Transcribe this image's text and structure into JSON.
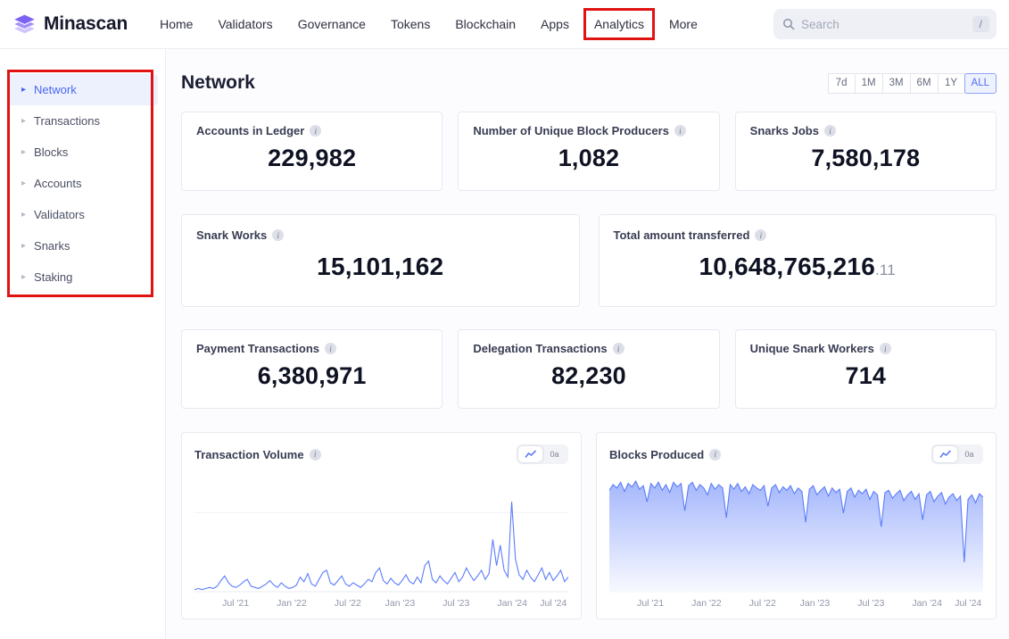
{
  "colors": {
    "accent": "#5b7cfa",
    "annotation": "#e01313",
    "active_blue": "#4a66f0"
  },
  "navbar": {
    "brand": "Minascan",
    "items": [
      {
        "label": "Home"
      },
      {
        "label": "Validators"
      },
      {
        "label": "Governance"
      },
      {
        "label": "Tokens"
      },
      {
        "label": "Blockchain"
      },
      {
        "label": "Apps"
      },
      {
        "label": "Analytics",
        "annotated": true
      },
      {
        "label": "More"
      }
    ],
    "search": {
      "placeholder": "Search",
      "shortcut": "/"
    }
  },
  "sidebar": {
    "items": [
      {
        "label": "Network",
        "active": true
      },
      {
        "label": "Transactions"
      },
      {
        "label": "Blocks"
      },
      {
        "label": "Accounts"
      },
      {
        "label": "Validators"
      },
      {
        "label": "Snarks"
      },
      {
        "label": "Staking"
      }
    ]
  },
  "main": {
    "title": "Network",
    "ranges": [
      "7d",
      "1M",
      "3M",
      "6M",
      "1Y",
      "ALL"
    ],
    "active_range": "ALL",
    "stats_row1": [
      {
        "label": "Accounts in Ledger",
        "value": "229,982"
      },
      {
        "label": "Number of Unique Block Producers",
        "value": "1,082"
      },
      {
        "label": "Snarks Jobs",
        "value": "7,580,178"
      }
    ],
    "stats_row2": [
      {
        "label": "Snark Works",
        "value": "15,101,162",
        "decimals": ""
      },
      {
        "label": "Total amount transferred",
        "value": "10,648,765,216",
        "decimals": ".11"
      }
    ],
    "stats_row3": [
      {
        "label": "Payment Transactions",
        "value": "6,380,971"
      },
      {
        "label": "Delegation Transactions",
        "value": "82,230"
      },
      {
        "label": "Unique Snark Workers",
        "value": "714"
      }
    ]
  },
  "charts": {
    "scale_toggle_label": "0a"
  },
  "chart_data": [
    {
      "type": "line",
      "title": "Transaction Volume",
      "color": "#5b7cfa",
      "x_ticks": [
        "Jul '21",
        "Jan '22",
        "Jul '22",
        "Jan '23",
        "Jul '23",
        "Jan '24",
        "Jul '24"
      ],
      "ylim": [
        0,
        100
      ],
      "values": [
        1,
        2,
        1,
        2,
        3,
        2,
        4,
        9,
        13,
        7,
        4,
        3,
        5,
        8,
        10,
        4,
        3,
        2,
        4,
        6,
        9,
        5,
        3,
        7,
        4,
        2,
        3,
        5,
        12,
        8,
        15,
        6,
        4,
        10,
        16,
        18,
        7,
        5,
        9,
        13,
        6,
        4,
        7,
        5,
        3,
        6,
        10,
        8,
        16,
        20,
        9,
        6,
        11,
        7,
        5,
        9,
        14,
        8,
        6,
        12,
        7,
        22,
        26,
        10,
        7,
        13,
        9,
        6,
        11,
        16,
        8,
        12,
        20,
        14,
        9,
        13,
        18,
        10,
        15,
        45,
        22,
        40,
        18,
        12,
        78,
        28,
        14,
        10,
        18,
        12,
        8,
        14,
        20,
        10,
        16,
        9,
        13,
        18,
        8,
        12
      ]
    },
    {
      "type": "area",
      "title": "Blocks Produced",
      "color": "#5b7cfa",
      "x_ticks": [
        "Jul '21",
        "Jan '22",
        "Jul '22",
        "Jan '23",
        "Jul '23",
        "Jan '24",
        "Jul '24"
      ],
      "ylim": [
        0,
        100
      ],
      "values": [
        88,
        93,
        90,
        95,
        87,
        94,
        91,
        96,
        89,
        92,
        78,
        94,
        90,
        95,
        88,
        93,
        86,
        95,
        91,
        94,
        70,
        92,
        95,
        88,
        93,
        90,
        84,
        94,
        89,
        93,
        90,
        64,
        93,
        89,
        94,
        87,
        91,
        85,
        93,
        90,
        88,
        92,
        74,
        90,
        93,
        86,
        91,
        88,
        92,
        85,
        90,
        87,
        60,
        89,
        92,
        84,
        88,
        91,
        83,
        90,
        86,
        89,
        68,
        87,
        90,
        82,
        88,
        85,
        89,
        80,
        87,
        84,
        56,
        86,
        88,
        81,
        85,
        88,
        79,
        84,
        87,
        80,
        85,
        62,
        84,
        87,
        78,
        83,
        86,
        76,
        82,
        85,
        79,
        83,
        25,
        80,
        84,
        77,
        85,
        82
      ]
    }
  ]
}
